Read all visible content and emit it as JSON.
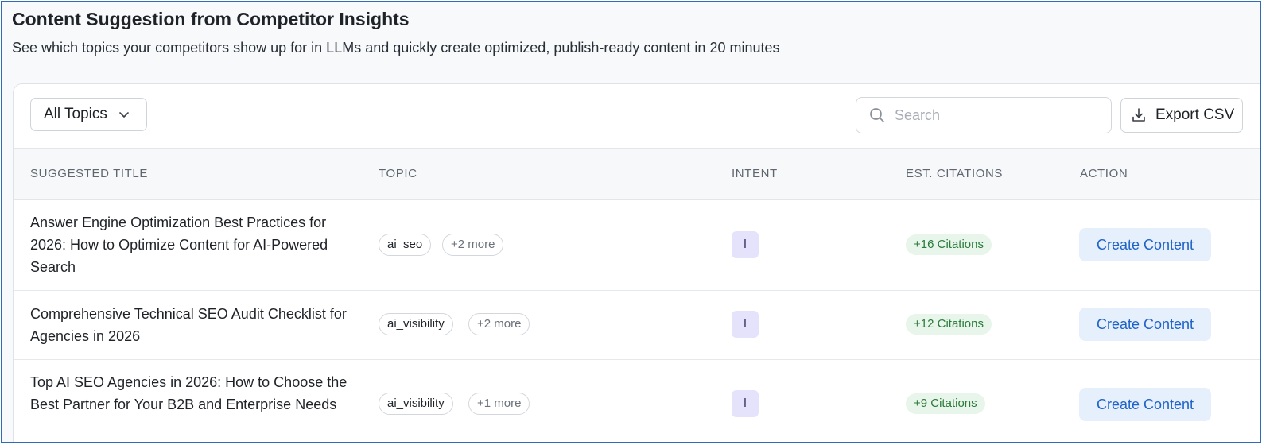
{
  "page": {
    "title": "Content Suggestion from Competitor Insights",
    "subtitle": "See which topics your competitors show up for in LLMs and quickly create optimized, publish-ready content in 20 minutes"
  },
  "toolbar": {
    "filter_label": "All Topics",
    "search_placeholder": "Search",
    "export_label": "Export CSV"
  },
  "table": {
    "columns": {
      "title": "SUGGESTED TITLE",
      "topic": "TOPIC",
      "intent": "INTENT",
      "citations": "EST. CITATIONS",
      "action": "ACTION"
    },
    "rows": [
      {
        "title": "Answer Engine Optimization Best Practices for 2026: How to Optimize Content for AI-Powered Search",
        "topic": "ai_seo",
        "more": "+2 more",
        "intent": "I",
        "citations": "+16 Citations",
        "action": "Create Content"
      },
      {
        "title": "Comprehensive Technical SEO Audit Checklist for Agencies in 2026",
        "topic": "ai_visibility",
        "more": "+2 more",
        "intent": "I",
        "citations": "+12 Citations",
        "action": "Create Content"
      },
      {
        "title": "Top AI SEO Agencies in 2026: How to Choose the Best Partner for Your B2B and Enterprise Needs",
        "topic": "ai_visibility",
        "more": "+1 more",
        "intent": "I",
        "citations": "+9 Citations",
        "action": "Create Content"
      }
    ]
  },
  "icons": {
    "filter": "chevron-down-icon",
    "search": "search-icon",
    "export": "download-icon"
  },
  "colors": {
    "frame_border": "#2e6cb8",
    "intent_badge_bg": "#e4e3fb",
    "citation_badge_bg": "#e8f5ea",
    "citation_text": "#2a7a3b",
    "action_bg": "#e6effc",
    "action_text": "#1f63c6"
  }
}
